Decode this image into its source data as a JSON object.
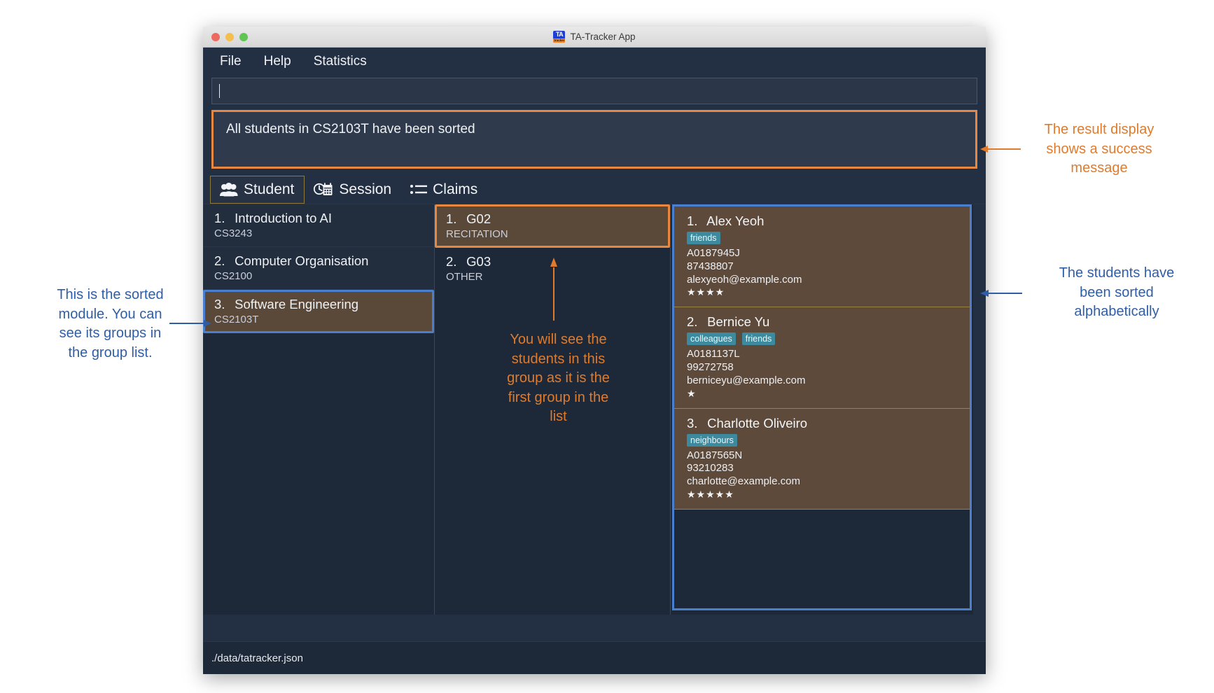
{
  "window": {
    "title": "TA-Tracker App",
    "app_icon_top": "TA",
    "app_icon_bottom": "tracker"
  },
  "menubar": {
    "items": [
      {
        "label": "File"
      },
      {
        "label": "Help"
      },
      {
        "label": "Statistics"
      }
    ]
  },
  "command_box": {
    "value": "",
    "placeholder": ""
  },
  "result_display": {
    "message": "All students in CS2103T have been sorted"
  },
  "tabs": [
    {
      "label": "Student",
      "icon": "people-icon",
      "active": true
    },
    {
      "label": "Session",
      "icon": "clock-calendar-icon",
      "active": false
    },
    {
      "label": "Claims",
      "icon": "list-icon",
      "active": false
    }
  ],
  "modules": [
    {
      "index": "1.",
      "name": "Introduction to AI",
      "code": "CS3243",
      "selected": false
    },
    {
      "index": "2.",
      "name": "Computer Organisation",
      "code": "CS2100",
      "selected": false
    },
    {
      "index": "3.",
      "name": "Software Engineering",
      "code": "CS2103T",
      "selected": true
    }
  ],
  "groups": [
    {
      "index": "1.",
      "name": "G02",
      "type": "RECITATION",
      "selected": true
    },
    {
      "index": "2.",
      "name": "G03",
      "type": "OTHER",
      "selected": false
    }
  ],
  "students": [
    {
      "index": "1.",
      "name": "Alex Yeoh",
      "tags": [
        "friends"
      ],
      "matric": "A0187945J",
      "phone": "87438807",
      "email": "alexyeoh@example.com",
      "rating": "★★★★"
    },
    {
      "index": "2.",
      "name": "Bernice Yu",
      "tags": [
        "colleagues",
        "friends"
      ],
      "matric": "A0181137L",
      "phone": "99272758",
      "email": "berniceyu@example.com",
      "rating": "★"
    },
    {
      "index": "3.",
      "name": "Charlotte Oliveiro",
      "tags": [
        "neighbours"
      ],
      "matric": "A0187565N",
      "phone": "93210283",
      "email": "charlotte@example.com",
      "rating": "★★★★★"
    }
  ],
  "footer": {
    "file_path": "./data/tatracker.json"
  },
  "annotations": {
    "result": "The result display\nshows a success\nmessage",
    "module": "This is the sorted\nmodule. You can\nsee its groups in\nthe group list.",
    "group": "You will see the\nstudents in this\ngroup as it is the\nfirst group in the\nlist",
    "students": "The students have\nbeen sorted\nalphabetically"
  },
  "colors": {
    "accent_orange": "#e8873f",
    "accent_blue": "#4a7fd0",
    "tag_teal": "#3d8a9e",
    "panel_bg": "#1d2838",
    "window_bg": "#232f42",
    "selected_card": "#5d4a3a"
  }
}
